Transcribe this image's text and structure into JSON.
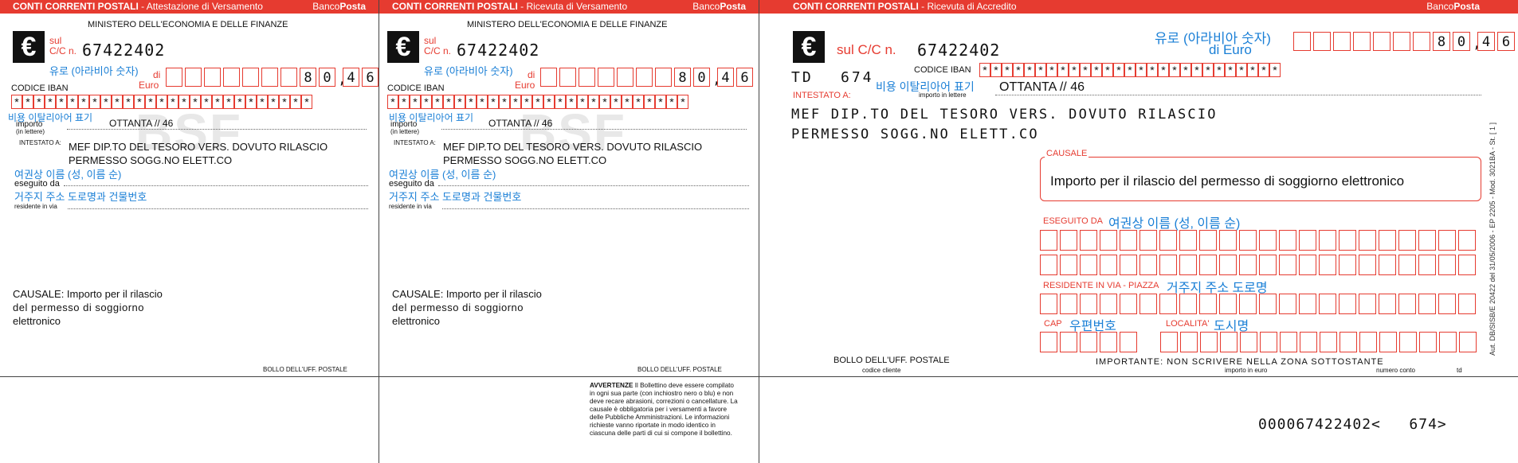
{
  "panel1": {
    "header_title": "CONTI CORRENTI POSTALI",
    "header_sub": " - Attestazione di Versamento",
    "brand_prefix": "Banco",
    "brand_suffix": "Posta",
    "ministry": "MINISTERO DELL'ECONOMIA E DELLE FINANZE",
    "sul": "sul",
    "cc": "C/C n.",
    "account": "67422402",
    "di": "di",
    "euro": "Euro",
    "amount_hint": "유로 (아라비아 숫자)",
    "amount_digits": [
      "",
      "",
      "",
      "",
      "",
      "",
      "",
      "8",
      "0",
      ",",
      "4",
      "6"
    ],
    "iban_label": "CODICE IBAN",
    "iban_chars": [
      "*",
      "*",
      "*",
      "*",
      "*",
      "*",
      "*",
      "*",
      "*",
      "*",
      "*",
      "*",
      "*",
      "*",
      "*",
      "*",
      "*",
      "*",
      "*",
      "*",
      "*",
      "*",
      "*",
      "*",
      "*",
      "*",
      "*"
    ],
    "words_hint": "비용 이탈리아어 표기",
    "importo": "importo",
    "in_lettere": "(in lettere)",
    "amount_words": "OTTANTA // 46",
    "watermark": "BSF",
    "intestato": "INTESTATO A:",
    "payee_line1": "MEF DIP.TO DEL TESORO VERS. DOVUTO RILASCIO",
    "payee_line2": "PERMESSO SOGG.NO ELETT.CO",
    "name_hint": "여권상 이름 (성, 이름 순)",
    "eseguito": "eseguito da",
    "address_hint": "거주지 주소 도로명과 건물번호",
    "residente": "residente in via",
    "causale_line1": "CAUSALE: Importo per il rilascio",
    "causale_line2": "del permesso di soggiorno",
    "causale_line3": "elettronico",
    "bollo": "BOLLO DELL'UFF. POSTALE"
  },
  "panel2": {
    "header_title": "CONTI CORRENTI POSTALI",
    "header_sub": " - Ricevuta di Versamento",
    "brand_prefix": "Banco",
    "brand_suffix": "Posta",
    "ministry": "MINISTERO DELL'ECONOMIA E DELLE FINANZE",
    "sul": "sul",
    "cc": "C/C n.",
    "account": "67422402",
    "di": "di",
    "euro": "Euro",
    "amount_hint": "유로 (아라비아 숫자)",
    "amount_digits": [
      "",
      "",
      "",
      "",
      "",
      "",
      "",
      "8",
      "0",
      ",",
      "4",
      "6"
    ],
    "iban_label": "CODICE IBAN",
    "iban_chars": [
      "*",
      "*",
      "*",
      "*",
      "*",
      "*",
      "*",
      "*",
      "*",
      "*",
      "*",
      "*",
      "*",
      "*",
      "*",
      "*",
      "*",
      "*",
      "*",
      "*",
      "*",
      "*",
      "*",
      "*",
      "*",
      "*",
      "*"
    ],
    "words_hint": "비용 이탈리아어 표기",
    "importo": "importo",
    "in_lettere": "(in lettere)",
    "amount_words": "OTTANTA // 46",
    "watermark": "BSF",
    "intestato": "INTESTATO A:",
    "payee_line1": "MEF DIP.TO DEL TESORO VERS. DOVUTO RILASCIO",
    "payee_line2": "PERMESSO SOGG.NO ELETT.CO",
    "name_hint": "여권상 이름 (성, 이름 순)",
    "eseguito": "eseguito da",
    "address_hint": "거주지 주소 도로명과 건물번호",
    "residente": "residente in via",
    "causale_line1": "CAUSALE: Importo per il rilascio",
    "causale_line2": "del permesso di soggiorno",
    "causale_line3": "elettronico",
    "bollo": "BOLLO DELL'UFF. POSTALE",
    "avvertenze_title": "AVVERTENZE",
    "avvertenze_lines": [
      " Il Bollettino deve essere compilato",
      "in ogni sua parte (con inchiostro nero o blu) e non",
      "deve recare abrasioni, correzioni o cancellature. La",
      "causale è obbligatoria per i versamenti a favore",
      "delle Pubbliche Amministrazioni. Le informazioni",
      "richieste vanno riportate in modo identico in",
      "ciascuna delle parti di cui si compone il bollettino."
    ]
  },
  "panel3": {
    "header_title": "CONTI CORRENTI POSTALI",
    "header_sub": " - Ricevuta di Accredito",
    "brand_prefix": "Banco",
    "brand_suffix": "Posta",
    "cc": "sul C/C n.",
    "account": "67422402",
    "amount_hint": "유로 (아라비아 숫자)",
    "di_euro": "di Euro",
    "amount_digits": [
      "",
      "",
      "",
      "",
      "",
      "",
      "",
      "8",
      "0",
      ",",
      "4",
      "6"
    ],
    "td": "TD",
    "td_value": "674",
    "iban_label": "CODICE IBAN",
    "iban_chars": [
      "*",
      "*",
      "*",
      "*",
      "*",
      "*",
      "*",
      "*",
      "*",
      "*",
      "*",
      "*",
      "*",
      "*",
      "*",
      "*",
      "*",
      "*",
      "*",
      "*",
      "*",
      "*",
      "*",
      "*",
      "*",
      "*",
      "*"
    ],
    "intestato": "INTESTATO A:",
    "words_hint": "비용 이탈리아어 표기",
    "importo_in_lettere": "importo in lettere",
    "amount_words": "OTTANTA // 46",
    "payee_line1": "MEF DIP.TO DEL TESORO VERS. DOVUTO RILASCIO",
    "payee_line2": "PERMESSO SOGG.NO ELETT.CO",
    "causale_label": "CAUSALE",
    "causale_text": "Importo per il rilascio del permesso di soggiorno elettronico",
    "eseguito_label": "ESEGUITO DA",
    "name_hint": "여권상 이름 (성, 이름 순)",
    "residente_label": "RESIDENTE IN VIA - PIAZZA",
    "address_hint": "거주지 주소 도로명",
    "cap_label": "CAP",
    "cap_hint": "우편번호",
    "localita_label": "LOCALITA'",
    "city_hint": "도시명",
    "bollo": "BOLLO DELL'UFF. POSTALE",
    "codice_cliente": "codice cliente",
    "importante": "IMPORTANTE: NON SCRIVERE NELLA ZONA SOTTOSTANTE",
    "importo_euro": "importo in euro",
    "numero_conto": "numero conto",
    "td_small": "td",
    "side_text": "Aut. DB/SISB/E 20422 del 31/05/2006 - EP 2205 - Mod. 3021BA - St. [ 1 ]",
    "ocr_line": "000067422402<   674>"
  }
}
